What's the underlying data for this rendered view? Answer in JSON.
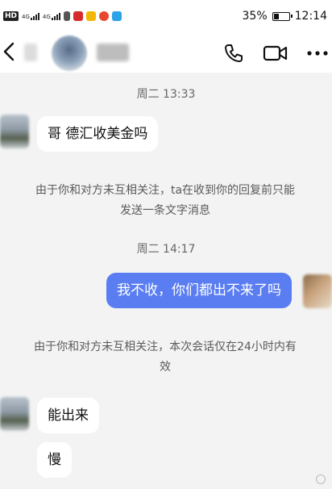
{
  "status_bar": {
    "hd_label": "HD",
    "network_1": "4G",
    "network_2": "4G",
    "battery_percent": "35%",
    "battery_level": 0.35,
    "time": "12:14"
  },
  "header": {
    "contact_name": ""
  },
  "messages": [
    {
      "kind": "time",
      "text": "周二 13:33"
    },
    {
      "kind": "in",
      "text": "哥 德汇收美金吗"
    },
    {
      "kind": "notice",
      "text": "由于你和对方未互相关注，ta在收到你的回复前只能发送一条文字消息"
    },
    {
      "kind": "time",
      "text": "周二 14:17"
    },
    {
      "kind": "out",
      "text": "我不收，你们都出不来了吗"
    },
    {
      "kind": "notice",
      "text": "由于你和对方未互相关注，本次会话仅在24小时内有效"
    },
    {
      "kind": "in",
      "text": "能出来"
    },
    {
      "kind": "in",
      "text": "慢"
    }
  ]
}
